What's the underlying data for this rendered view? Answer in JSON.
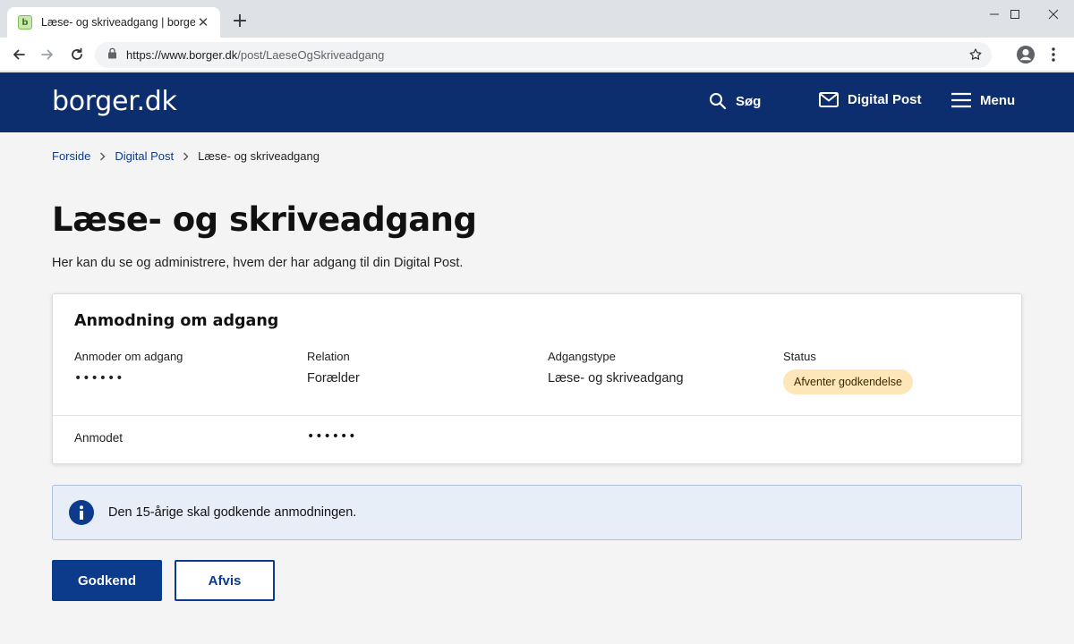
{
  "browser": {
    "tab_title": "Læse- og skriveadgang | borger.dk",
    "favicon_letter": "b",
    "url_host": "https://www.borger.dk",
    "url_path": "/post/LaeseOgSkriveadgang"
  },
  "header": {
    "logo": "borger.dk",
    "search_label": "Søg",
    "digital_post_label": "Digital Post",
    "menu_label": "Menu",
    "background_color": "#0d2e6e"
  },
  "breadcrumb": {
    "items": [
      "Forside",
      "Digital Post"
    ],
    "current": "Læse- og skriveadgang"
  },
  "page": {
    "title": "Læse- og skriveadgang",
    "lead": "Her kan du se og administrere, hvem der har adgang til din Digital Post."
  },
  "card": {
    "title": "Anmodning om adgang",
    "columns": [
      {
        "label": "Anmoder om adgang",
        "value": "••••••"
      },
      {
        "label": "Relation",
        "value": "Forælder"
      },
      {
        "label": "Adgangstype",
        "value": "Læse- og skriveadgang"
      },
      {
        "label": "Status",
        "value": "Afventer godkendelse"
      }
    ],
    "requested_label": "Anmodet",
    "requested_value": "••••••",
    "status_badge_color": "#fde6b7"
  },
  "info": {
    "text": "Den 15-årige skal godkende anmodningen."
  },
  "actions": {
    "approve_label": "Godkend",
    "reject_label": "Afvis",
    "primary_color": "#0d3b8c"
  }
}
